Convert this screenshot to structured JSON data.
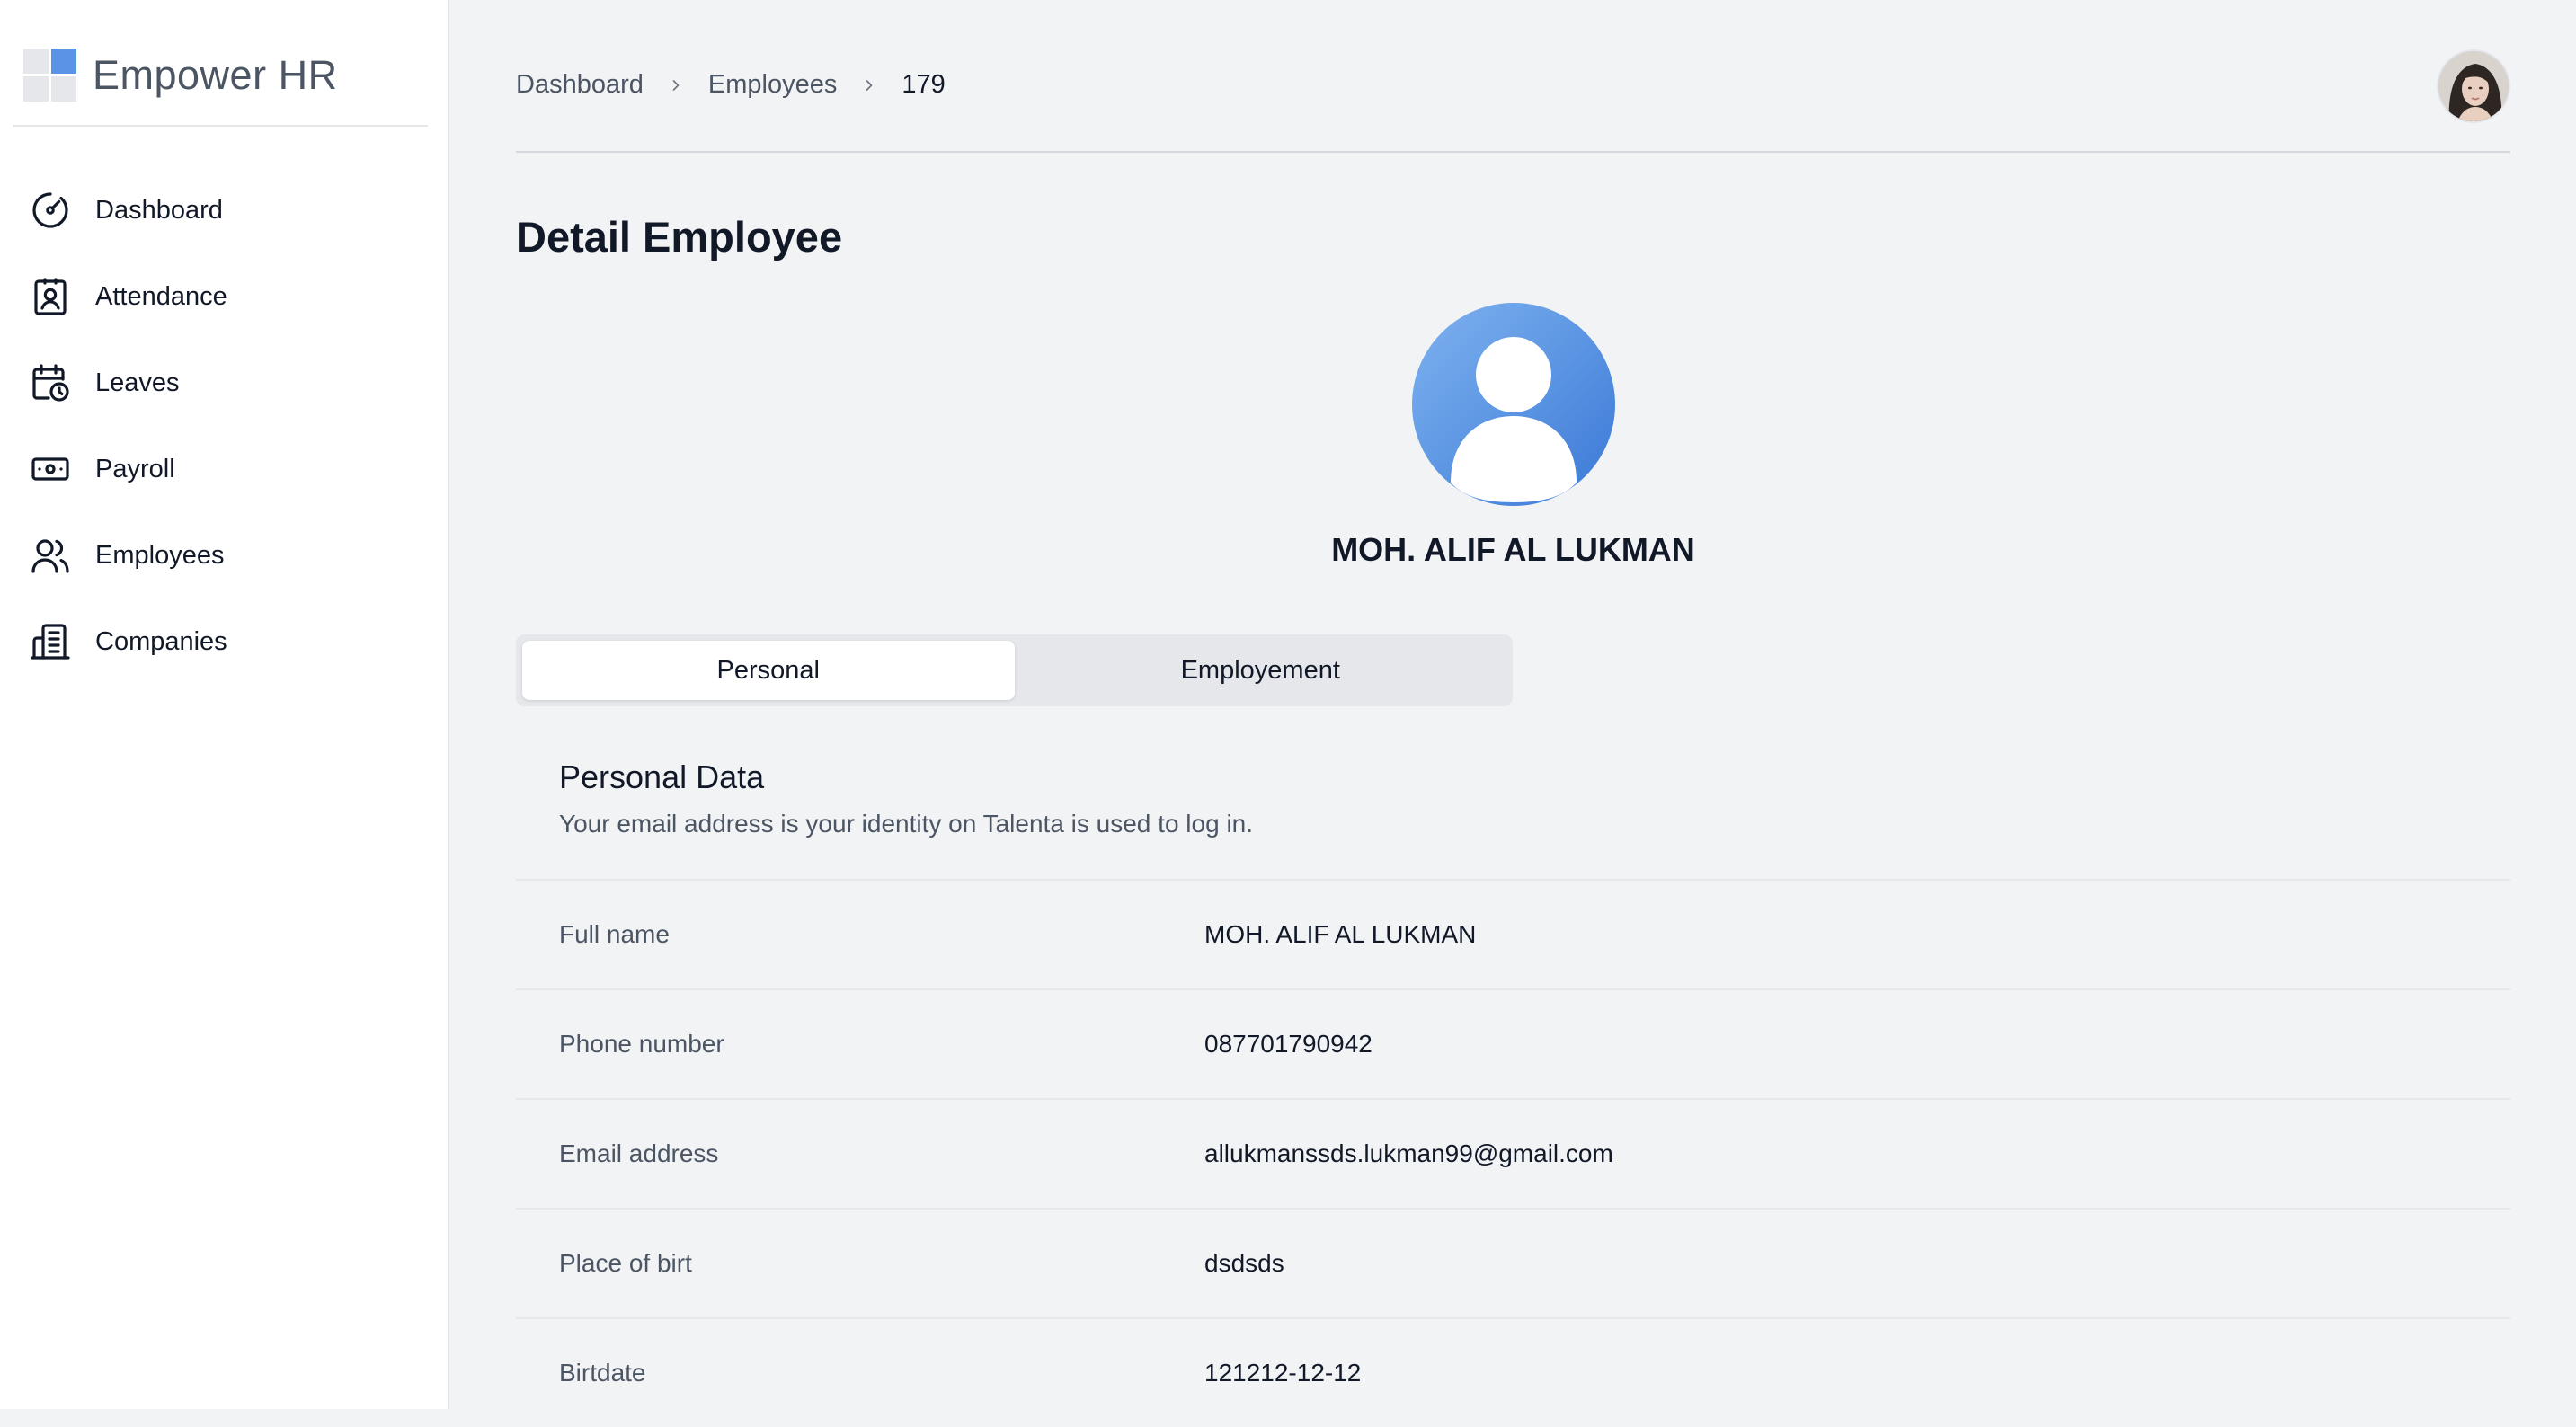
{
  "brand": {
    "name": "Empower HR",
    "accent_color": "#5b93e6"
  },
  "sidebar": {
    "items": [
      {
        "label": "Dashboard",
        "icon": "gauge-icon"
      },
      {
        "label": "Attendance",
        "icon": "badge-user-icon"
      },
      {
        "label": "Leaves",
        "icon": "calendar-clock-icon"
      },
      {
        "label": "Payroll",
        "icon": "banknote-icon"
      },
      {
        "label": "Employees",
        "icon": "users-icon"
      },
      {
        "label": "Companies",
        "icon": "building-icon"
      }
    ]
  },
  "breadcrumb": {
    "items": [
      "Dashboard",
      "Employees",
      "179"
    ]
  },
  "page": {
    "title": "Detail Employee"
  },
  "profile": {
    "name": "MOH. ALIF AL LUKMAN",
    "avatar_color": "#4a8ae0"
  },
  "tabs": [
    {
      "label": "Personal",
      "active": true
    },
    {
      "label": "Employement",
      "active": false
    }
  ],
  "personal_section": {
    "title": "Personal Data",
    "description": "Your email address is your identity on Talenta is used to log in."
  },
  "details": [
    {
      "label": "Full name",
      "value": "MOH. ALIF AL LUKMAN"
    },
    {
      "label": "Phone number",
      "value": "087701790942"
    },
    {
      "label": "Email address",
      "value": "allukmanssds.lukman99@gmail.com"
    },
    {
      "label": "Place of birt",
      "value": "dsdsds"
    },
    {
      "label": "Birtdate",
      "value": "121212-12-12"
    }
  ]
}
